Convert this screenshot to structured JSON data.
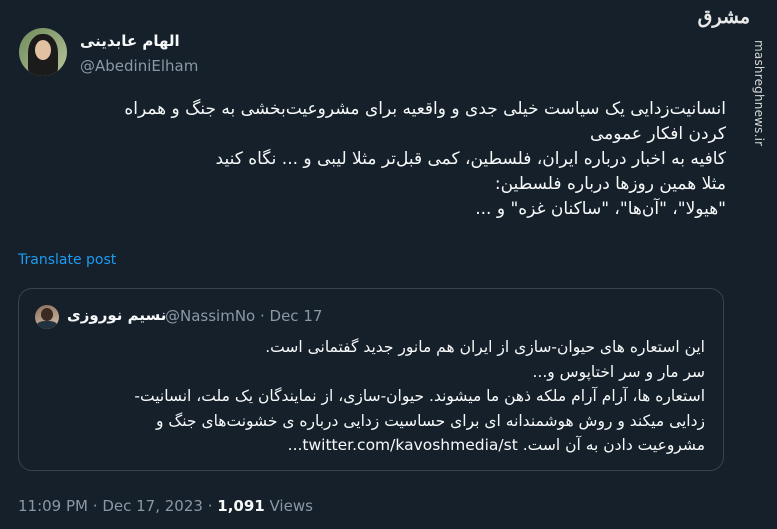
{
  "author": {
    "display_name": "الهام عابدینی",
    "handle": "@AbediniElham"
  },
  "watermark": {
    "logo_text": "مشرق",
    "side_text": "mashreghnews.ir"
  },
  "tweet": {
    "lines": [
      "انسانیت‌زدایی یک سیاست خیلی جدی و واقعیه برای مشروعیت‌بخشی به جنگ و همراه",
      "کردن افکار عمومی",
      "کافیه به اخبار درباره ایران، فلسطین، کمی قبل‌تر مثلا لیبی و ... نگاه کنید",
      "مثلا همین روزها درباره فلسطین:",
      "\"هیولا\"، \"آن‌ها\"، \"ساکنان غزه\" و ..."
    ],
    "translate_label": "Translate post"
  },
  "quote": {
    "display_name": "نسیم نوروزی",
    "handle_date": "@NassimNo · Dec 17",
    "lines": [
      "این استعاره های حیوان-سازی از ایران هم مانور جدید گفتمانی است.",
      "سر مار و سر اختاپوس و...",
      "استعاره ها، آرام آرام ملکه ذهن ما میشوند. حیوان-سازی، از نمایندگان یک ملت، انسانیت-",
      "زدایی میکند و روش هوشمندانه ای برای حساسیت زدایی درباره ی خشونت‌های جنگ و",
      "مشروعیت دادن به آن است. twitter.com/kavoshmedia/st..."
    ]
  },
  "meta": {
    "time": "11:09 PM",
    "date": "Dec 17, 2023",
    "separator": "·",
    "views_count": "1,091",
    "views_label": "Views"
  },
  "colors": {
    "background": "#15202b",
    "text": "#f7f9f9",
    "secondary": "#8b98a5",
    "link": "#1d9bf0",
    "border": "#38444d"
  }
}
